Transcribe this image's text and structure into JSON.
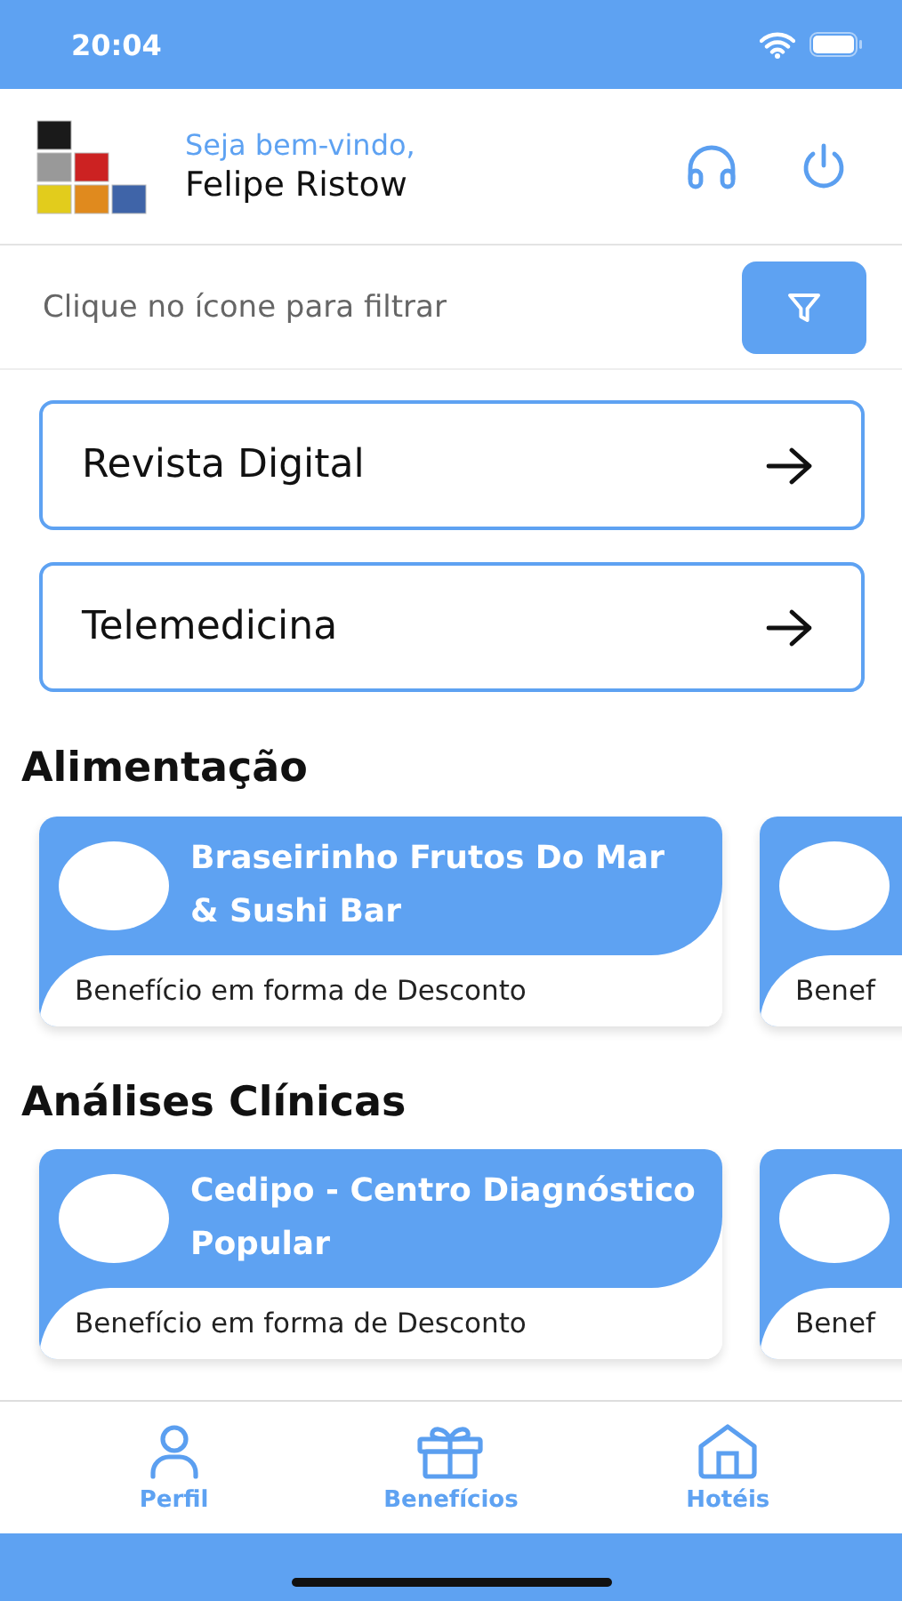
{
  "status_bar": {
    "time": "20:04"
  },
  "header": {
    "greeting": "Seja bem-vindo,",
    "user_name": "Felipe Ristow"
  },
  "filter": {
    "placeholder": "Clique no ícone para filtrar"
  },
  "links": [
    {
      "label": "Revista Digital"
    },
    {
      "label": "Telemedicina"
    }
  ],
  "sections": [
    {
      "title": "Alimentação",
      "cards": [
        {
          "title": "Braseirinho Frutos Do Mar & Sushi Bar",
          "description": "Benefício em forma de Desconto"
        },
        {
          "description": "Benef"
        }
      ]
    },
    {
      "title": "Análises Clínicas",
      "cards": [
        {
          "title": "Cedipo - Centro Diagnóstico Popular",
          "description": "Benefício em forma de Desconto"
        },
        {
          "description": "Benef"
        }
      ]
    }
  ],
  "tab_bar": [
    {
      "label": "Perfil",
      "kind": "person"
    },
    {
      "label": "Benefícios",
      "kind": "gift"
    },
    {
      "label": "Hotéis",
      "kind": "house"
    }
  ]
}
